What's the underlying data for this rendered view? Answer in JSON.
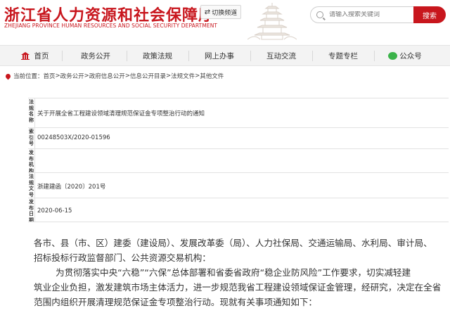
{
  "header": {
    "title_cn": "浙江省人力资源和社会保障厅",
    "title_en": "ZHEJIANG PROVINCE HUMAN RESOURCES AND SOCIAL SECURITY DEPARTMENT",
    "switch_label": "切换频道",
    "search_placeholder": "请输入搜索关键词",
    "search_button": "搜索",
    "brand_color": "#c8161d"
  },
  "nav": {
    "items": [
      {
        "label": "首页",
        "icon": "home-icon"
      },
      {
        "label": "政务公开"
      },
      {
        "label": "政策法规"
      },
      {
        "label": "网上办事"
      },
      {
        "label": "互动交流"
      },
      {
        "label": "专题专栏"
      },
      {
        "label": "公众号",
        "icon": "wechat-icon"
      }
    ]
  },
  "breadcrumb": {
    "prefix": "当前位置：",
    "path": [
      "首页",
      "政务公开",
      "政府信息公开",
      "信息公开目录",
      "法规文件",
      "其他文件"
    ],
    "separator": " > "
  },
  "info": {
    "rows": [
      {
        "label": "法规名称",
        "value": "关于开展全省工程建设领域清理规范保证金专项整治行动的通知"
      },
      {
        "label": "索引号",
        "value": "00248503X/2020-01596"
      },
      {
        "label": "发布机构",
        "value": ""
      },
      {
        "label": "法规文号",
        "value": "浙建建函〔2020〕201号"
      },
      {
        "label": "发布日期",
        "value": "2020-06-15"
      }
    ]
  },
  "content": {
    "lines": [
      "各市、县（市、区）建委（建设局）、发展改革委（局）、人力社保局、交通运输局、水利局、审计局、",
      "招标投标行政监督部门、公共资源交易机构：",
      "为贯彻落实中央“六稳”“六保”总体部署和省委省政府“稳企业防风险”工作要求，切实减轻建",
      "筑业企业负担，激发建筑市场主体活力，进一步规范我省工程建设领域保证金管理，经研究，决定在全省",
      "范围内组织开展清理规范保证金专项整治行动。现就有关事项通知如下："
    ]
  }
}
